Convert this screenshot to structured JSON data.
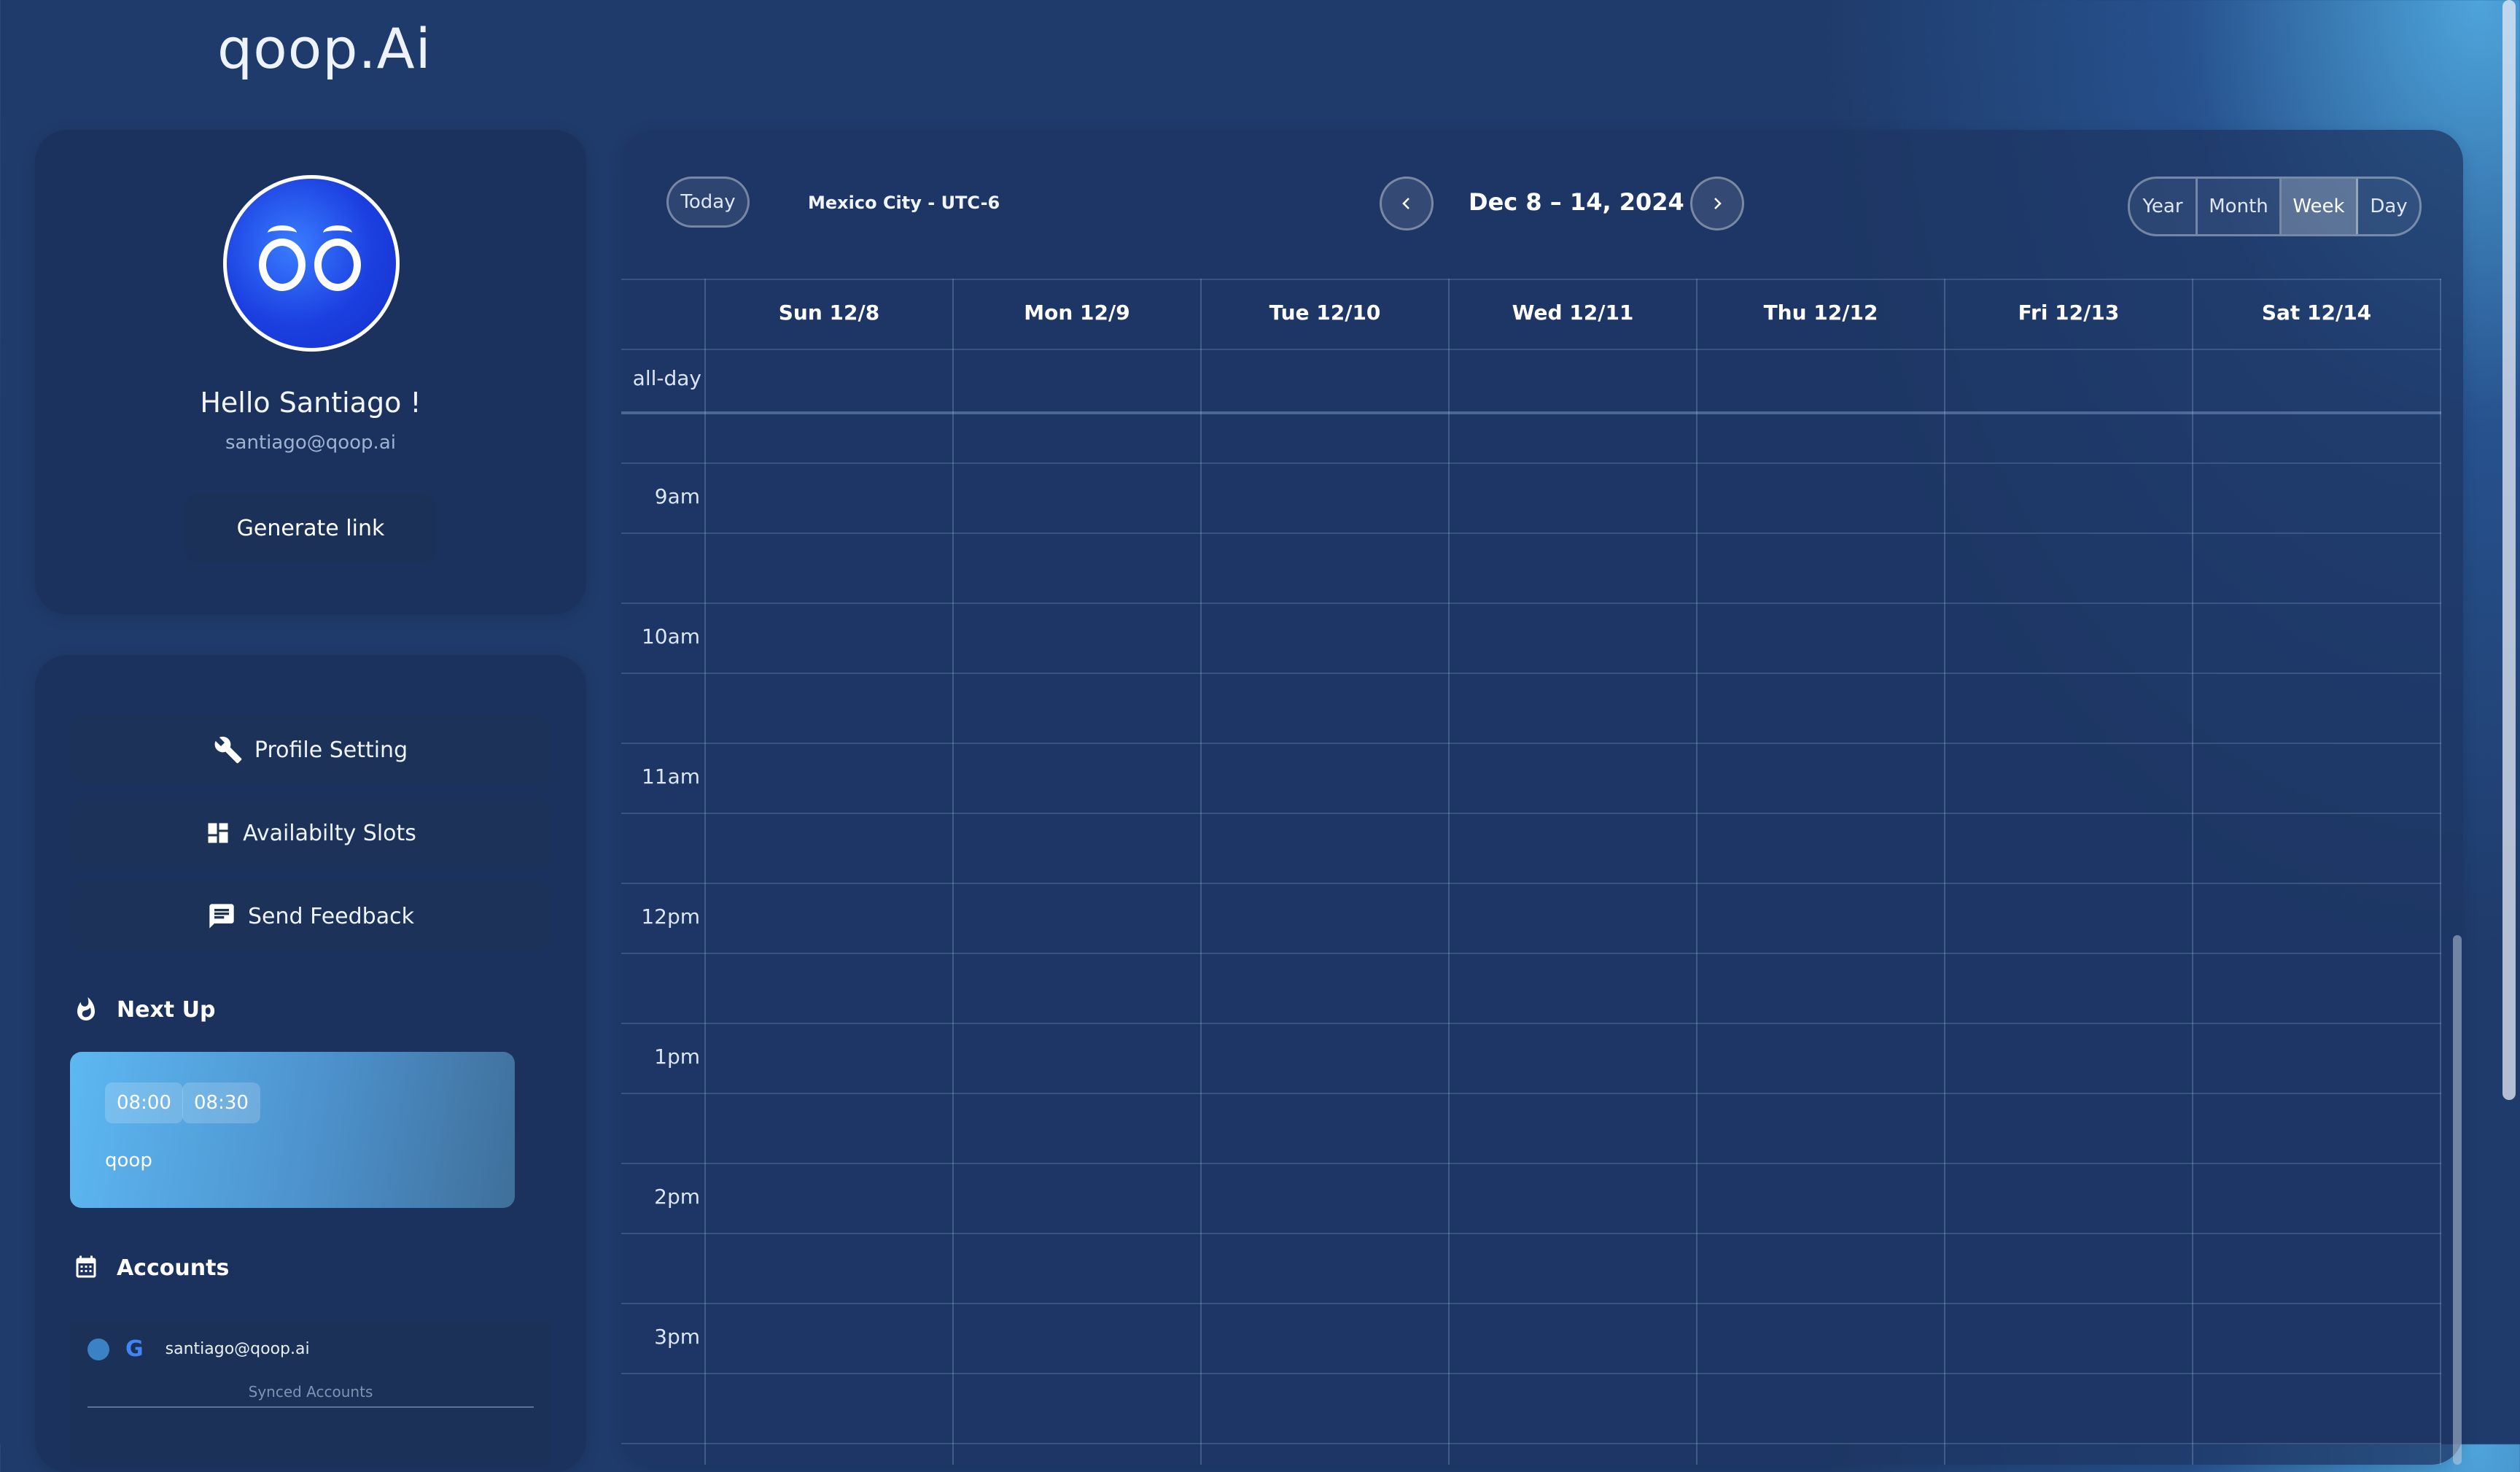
{
  "brand": {
    "logo_text": "qoop.Ai"
  },
  "profile": {
    "greeting": "Hello Santiago !",
    "email": "santiago@qoop.ai",
    "generate_link_label": "Generate link"
  },
  "menu": {
    "items": [
      {
        "label": "Profile Setting",
        "icon": "wrench-icon"
      },
      {
        "label": "Availabilty Slots",
        "icon": "dashboard-icon"
      },
      {
        "label": "Send Feedback",
        "icon": "feedback-icon"
      }
    ]
  },
  "next_up": {
    "title": "Next Up",
    "event": {
      "start": "08:00",
      "end": "08:30",
      "title": "qoop"
    }
  },
  "accounts": {
    "title": "Accounts",
    "items": [
      {
        "email": "santiago@qoop.ai",
        "provider": "G"
      }
    ],
    "synced_label": "Synced Accounts"
  },
  "calendar": {
    "today_label": "Today",
    "timezone": "Mexico City - UTC-6",
    "range_title": "Dec 8 – 14, 2024",
    "views": [
      "Year",
      "Month",
      "Week",
      "Day"
    ],
    "active_view": "Week",
    "days": [
      "Sun 12/8",
      "Mon 12/9",
      "Tue 12/10",
      "Wed 12/11",
      "Thu 12/12",
      "Fri 12/13",
      "Sat 12/14"
    ],
    "allday_label": "all-day",
    "hours": [
      "9am",
      "10am",
      "11am",
      "12pm",
      "1pm",
      "2pm",
      "3pm"
    ]
  },
  "colors": {
    "background": "#1f3b6b",
    "panel": "#1d3663",
    "accent_card": "#5db8f2",
    "avatar": "#1b3fe0"
  }
}
